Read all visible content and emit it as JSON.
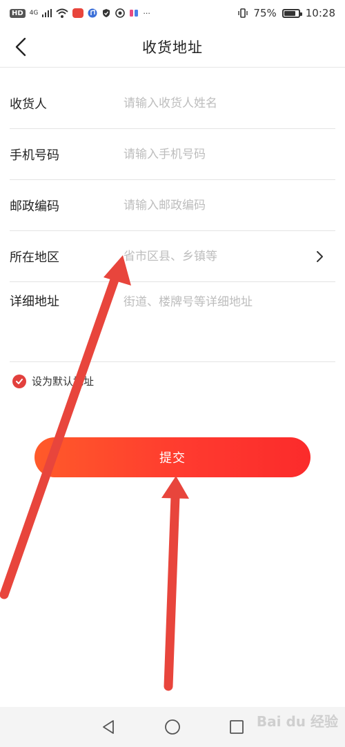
{
  "status_bar": {
    "hd": "HD",
    "network": "4G",
    "more": "···",
    "battery_percent": "75%",
    "battery_level": 0.75,
    "time": "10:28"
  },
  "header": {
    "title": "收货地址"
  },
  "form": {
    "recipient": {
      "label": "收货人",
      "placeholder": "请输入收货人姓名"
    },
    "phone": {
      "label": "手机号码",
      "placeholder": "请输入手机号码"
    },
    "postal": {
      "label": "邮政编码",
      "placeholder": "请输入邮政编码"
    },
    "region": {
      "label": "所在地区",
      "placeholder": "省市区县、乡镇等"
    },
    "detail": {
      "label": "详细地址",
      "placeholder": "街道、楼牌号等详细地址"
    }
  },
  "default_address": {
    "label": "设为默认地址",
    "checked": true
  },
  "submit": {
    "label": "提交"
  },
  "watermark": "Bai du 经验",
  "colors": {
    "accent": "#e2403d",
    "submit_start": "#ff5a2a",
    "submit_end": "#fb2b2b",
    "annotation_arrow": "#e8453c",
    "placeholder": "#bdbdbd"
  },
  "icons": {
    "back": "chevron-left-icon",
    "region_chevron": "chevron-right-icon",
    "check": "check-icon",
    "nav_back": "triangle-back-icon",
    "nav_home": "circle-home-icon",
    "nav_recents": "square-recents-icon"
  }
}
